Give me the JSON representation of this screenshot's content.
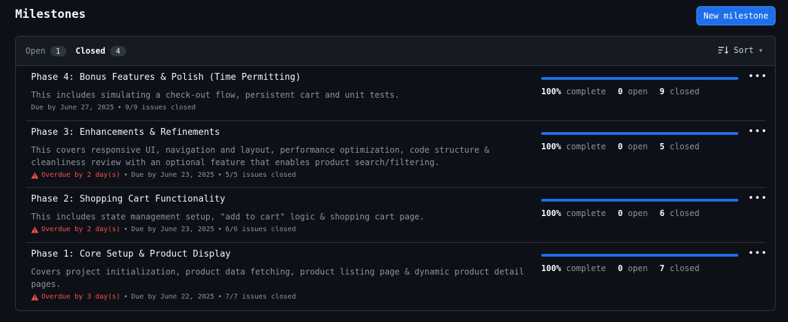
{
  "page": {
    "title": "Milestones",
    "new_button": "New milestone"
  },
  "tabs": {
    "open": {
      "label": "Open",
      "count": "1"
    },
    "closed": {
      "label": "Closed",
      "count": "4"
    }
  },
  "sort": {
    "label": "Sort"
  },
  "colors": {
    "accent": "#1f6feb",
    "danger": "#f85149",
    "muted": "#8b949e"
  },
  "milestones": [
    {
      "title": "Phase 4: Bonus Features & Polish (Time Permitting)",
      "description": "This includes simulating a check-out flow, persistent cart and unit tests.",
      "overdue": "",
      "due": "Due by June 27, 2025",
      "issues_closed": "9/9 issues closed",
      "percent": "100%",
      "percent_value": 100,
      "complete_label": "complete",
      "open_count": "0",
      "open_label": "open",
      "closed_count": "9",
      "closed_label": "closed"
    },
    {
      "title": "Phase 3: Enhancements & Refinements",
      "description": "This covers responsive UI, navigation and layout, performance optimization, code structure & cleanliness review with an optional feature that enables product search/filtering.",
      "overdue": "Overdue by 2 day(s)",
      "due": "Due by June 23, 2025",
      "issues_closed": "5/5 issues closed",
      "percent": "100%",
      "percent_value": 100,
      "complete_label": "complete",
      "open_count": "0",
      "open_label": "open",
      "closed_count": "5",
      "closed_label": "closed"
    },
    {
      "title": "Phase 2: Shopping Cart Functionality",
      "description": "This includes state management setup, \"add to cart\" logic & shopping cart page.",
      "overdue": "Overdue by 2 day(s)",
      "due": "Due by June 23, 2025",
      "issues_closed": "6/6 issues closed",
      "percent": "100%",
      "percent_value": 100,
      "complete_label": "complete",
      "open_count": "0",
      "open_label": "open",
      "closed_count": "6",
      "closed_label": "closed"
    },
    {
      "title": "Phase 1: Core Setup & Product Display",
      "description": "Covers project initialization, product data fetching, product listing page & dynamic product detail pages.",
      "overdue": "Overdue by 3 day(s)",
      "due": "Due by June 22, 2025",
      "issues_closed": "7/7 issues closed",
      "percent": "100%",
      "percent_value": 100,
      "complete_label": "complete",
      "open_count": "0",
      "open_label": "open",
      "closed_count": "7",
      "closed_label": "closed"
    }
  ]
}
